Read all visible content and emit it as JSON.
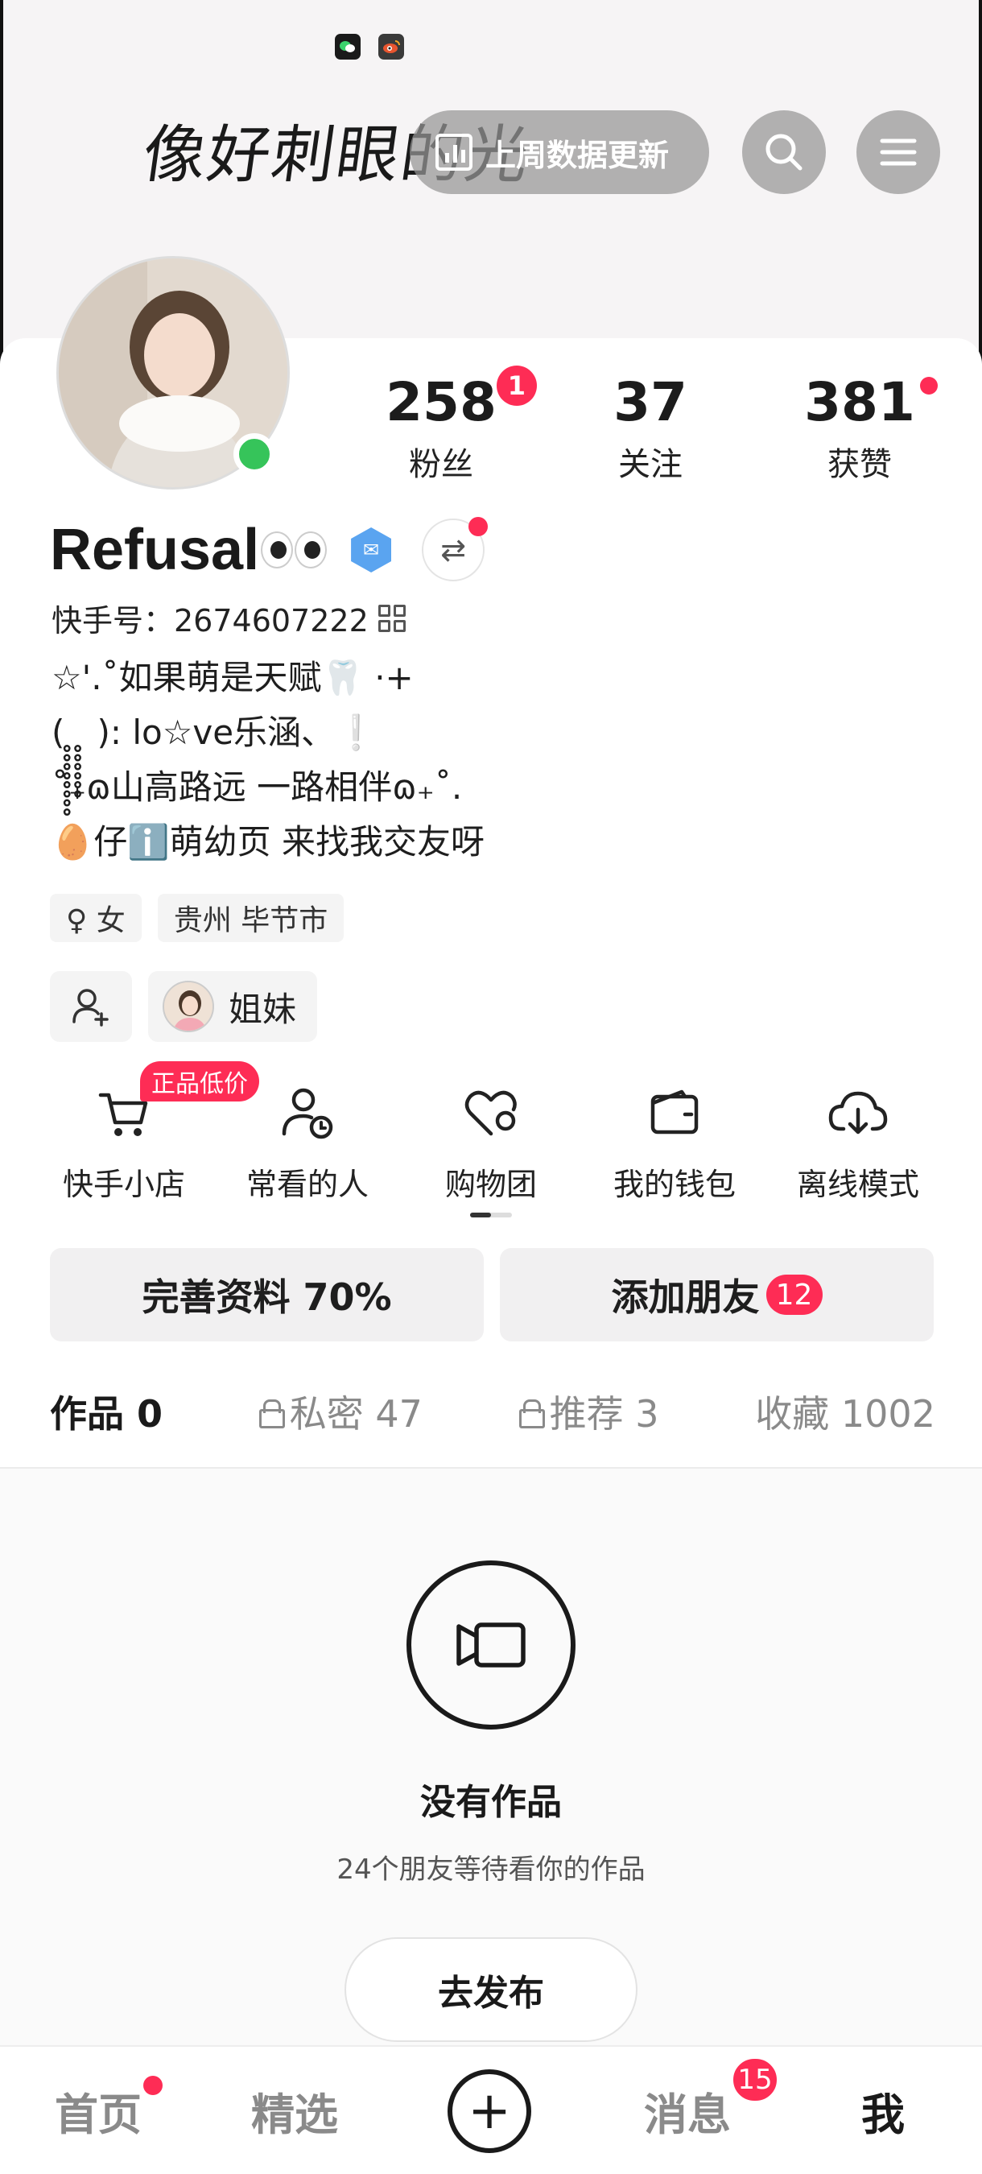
{
  "banner": {
    "status_icons": [
      "wechat-icon",
      "weibo-icon"
    ],
    "script_text": "像好刺眼的光",
    "weekly_label": "上周数据更新"
  },
  "profile": {
    "stats": [
      {
        "value": "258",
        "label": "粉丝",
        "badge": "1"
      },
      {
        "value": "37",
        "label": "关注"
      },
      {
        "value": "381",
        "label": "获赞",
        "has_dot": true
      }
    ],
    "name": "Refusal",
    "kuaishou_id": "快手号：2674607222",
    "bio": [
      "☆'.˚如果萌是天赋🦷 ·+",
      "( ̥̥̥̥̥̥̥̥ ̥̥̥̥̥̥ ): lo☆ve乐涵、❕",
      "˚₊ɷ山高路远 一路相伴ɷ₊˚.",
      "🥚仔ℹ️萌幼页 来找我交友呀"
    ],
    "tags": [
      "♀ 女",
      "贵州 毕节市"
    ],
    "sister_label": "姐妹"
  },
  "tools": [
    {
      "label": "快手小店",
      "icon": "cart-icon",
      "promo": "正品低价"
    },
    {
      "label": "常看的人",
      "icon": "user-clock-icon"
    },
    {
      "label": "购物团",
      "icon": "heart-group-icon"
    },
    {
      "label": "我的钱包",
      "icon": "wallet-icon"
    },
    {
      "label": "离线模式",
      "icon": "cloud-download-icon"
    }
  ],
  "actions": {
    "complete_profile": "完善资料 70%",
    "add_friends": "添加朋友",
    "add_friends_count": "12"
  },
  "tabs": [
    {
      "label": "作品 0",
      "active": true
    },
    {
      "label": "私密 47",
      "locked": true
    },
    {
      "label": "推荐 3",
      "locked": true
    },
    {
      "label": "收藏 1002"
    }
  ],
  "empty": {
    "title": "没有作品",
    "subtitle": "24个朋友等待看你的作品",
    "publish": "去发布"
  },
  "bottom_nav": {
    "home": "首页",
    "featured": "精选",
    "messages": "消息",
    "messages_count": "15",
    "me": "我"
  },
  "colors": {
    "accent": "#fe2c55",
    "online": "#36c45a"
  }
}
